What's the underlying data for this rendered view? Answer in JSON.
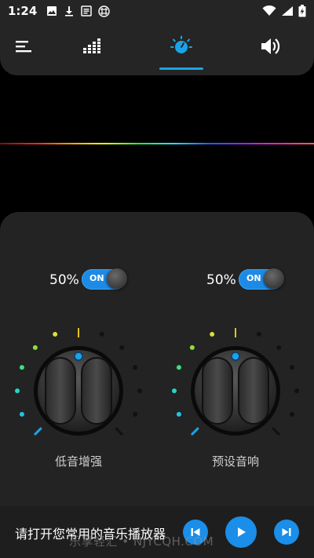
{
  "status": {
    "time": "1:24",
    "left_icons": [
      "image-icon",
      "download-icon",
      "text-icon",
      "crosshatch-icon"
    ],
    "right_icons": [
      "wifi-icon",
      "signal-icon",
      "battery-charging-icon"
    ]
  },
  "tabs": [
    {
      "icon": "menu-icon",
      "active": false
    },
    {
      "icon": "equalizer-icon",
      "active": false
    },
    {
      "icon": "bass-knob-icon",
      "active": true
    },
    {
      "icon": "speaker-icon",
      "active": false
    }
  ],
  "colors": {
    "accent": "#1a8ee8",
    "panel": "#232323",
    "bar": "#252525"
  },
  "controls": [
    {
      "percent": "50%",
      "toggle_label": "ON",
      "caption": "低音增强",
      "level": 0.5
    },
    {
      "percent": "50%",
      "toggle_label": "ON",
      "caption": "预设音响",
      "level": 0.5
    }
  ],
  "player": {
    "message": "请打开您常用的音乐播放器",
    "buttons": [
      "previous-icon",
      "play-icon",
      "next-icon"
    ]
  },
  "watermark": "乐享轻汇 • NJYCQH.COM"
}
